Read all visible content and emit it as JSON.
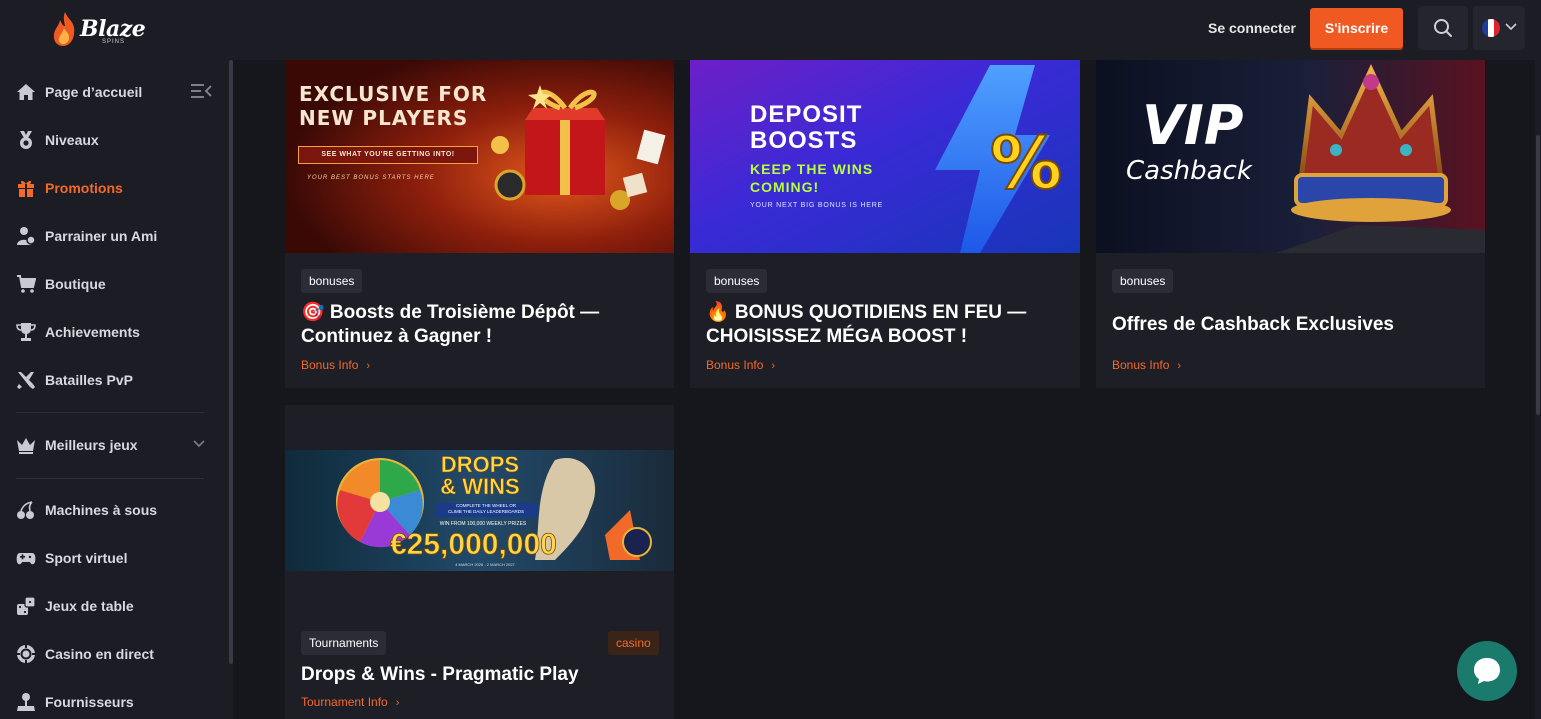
{
  "brand": {
    "name": "Blaze",
    "sub": "SPINS"
  },
  "header": {
    "login_label": "Se connecter",
    "signup_label": "S'inscrire",
    "search_icon": "search-icon",
    "language_flag": "france-flag"
  },
  "sidebar": {
    "items": [
      {
        "label": "Page d’accueil",
        "icon": "home-icon",
        "active": false
      },
      {
        "label": "Niveaux",
        "icon": "medal-icon",
        "active": false
      },
      {
        "label": "Promotions",
        "icon": "gift-icon",
        "active": true
      },
      {
        "label": "Parrainer un Ami",
        "icon": "referral-icon",
        "active": false
      },
      {
        "label": "Boutique",
        "icon": "cart-icon",
        "active": false
      },
      {
        "label": "Achievements",
        "icon": "trophy-icon",
        "active": false
      },
      {
        "label": "Batailles PvP",
        "icon": "swords-icon",
        "active": false
      },
      {
        "label": "Meilleurs jeux",
        "icon": "crown-icon",
        "active": false
      },
      {
        "label": "Machines à sous",
        "icon": "cherries-icon",
        "active": false
      },
      {
        "label": "Sport virtuel",
        "icon": "gamepad-icon",
        "active": false
      },
      {
        "label": "Jeux de table",
        "icon": "dice-icon",
        "active": false
      },
      {
        "label": "Casino en direct",
        "icon": "chip-icon",
        "active": false
      },
      {
        "label": "Fournisseurs",
        "icon": "joystick-icon",
        "active": false
      }
    ]
  },
  "promotions": [
    {
      "banner": {
        "headline": "EXCLUSIVE FOR NEW PLAYERS",
        "line1": "EXCLUSIVE FOR",
        "line2": "NEW PLAYERS",
        "cta": "SEE WHAT YOU'RE GETTING INTO!",
        "tagline": "YOUR BEST BONUS STARTS HERE"
      },
      "tag": "bonuses",
      "title_line1": "🎯 Boosts de Troisième Dépôt —",
      "title_line2": "Continuez à Gagner !",
      "link": "Bonus Info"
    },
    {
      "banner": {
        "line1": "DEPOSIT",
        "line2": "BOOSTS",
        "line3": "KEEP THE WINS",
        "line4": "COMING!",
        "tagline": "YOUR NEXT BIG BONUS IS HERE",
        "symbol": "%"
      },
      "tag": "bonuses",
      "title_line1": "🔥 BONUS QUOTIDIENS EN FEU —",
      "title_line2": "CHOISISSEZ MÉGA BOOST !",
      "link": "Bonus Info"
    },
    {
      "banner": {
        "line1": "VIP",
        "line2": "Cashback"
      },
      "tag": "bonuses",
      "title_line1": "Offres de Cashback Exclusives",
      "link": "Bonus Info"
    },
    {
      "banner": {
        "line1": "DROPS",
        "line2": "& WINS",
        "prize": "€25,000,000",
        "sub1": "COMPLETE THE WHEEL OR",
        "sub2": "CLIMB THE DAILY LEADERBOARDS",
        "sub3": "WIN FROM 100,000 WEEKLY PRIZES",
        "dates": "4 MARCH 2026 - 2 MARCH 2027"
      },
      "tag": "Tournaments",
      "tag2": "casino",
      "title_line1": "Drops & Wins - Pragmatic Play",
      "link": "Tournament Info"
    }
  ],
  "chat": {
    "icon": "chat-icon"
  }
}
